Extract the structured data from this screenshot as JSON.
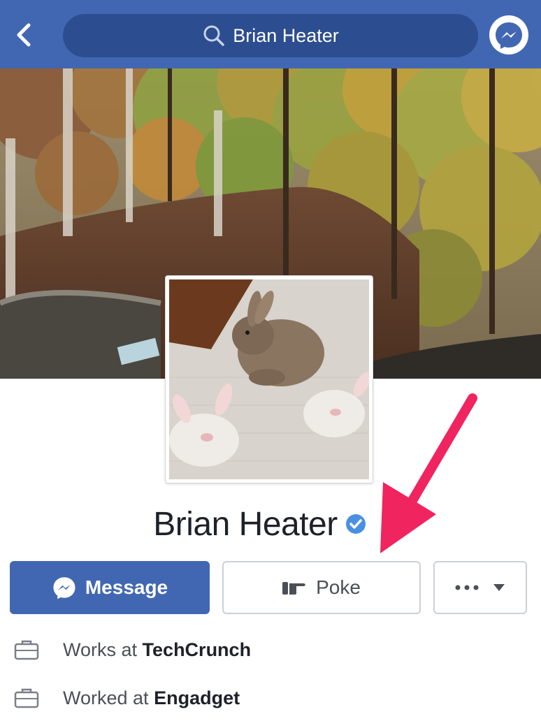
{
  "header": {
    "search_value": "Brian Heater",
    "icons": [
      "back-arrow-icon",
      "search-icon",
      "messenger-icon"
    ]
  },
  "profile": {
    "name": "Brian Heater",
    "verified": true,
    "colors": {
      "brand": "#4267b2",
      "verified": "#4a90e2",
      "annotation_arrow": "#f0245f"
    }
  },
  "actions": {
    "message_label": "Message",
    "poke_label": "Poke",
    "more_icon": "ellipsis-icon"
  },
  "details": [
    {
      "prefix": "Works at",
      "org": "TechCrunch",
      "icon": "briefcase-icon"
    },
    {
      "prefix": "Worked at",
      "org": "Engadget",
      "icon": "briefcase-icon"
    }
  ]
}
